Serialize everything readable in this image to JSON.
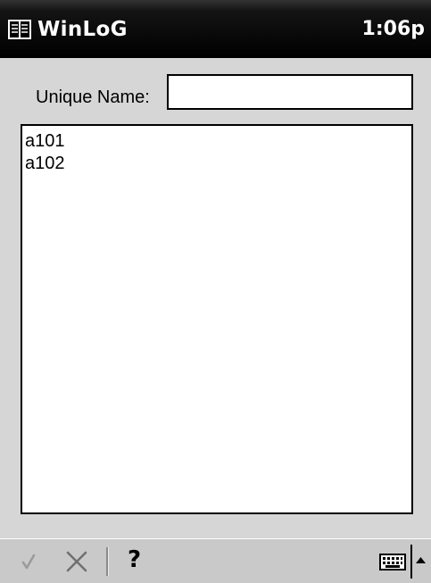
{
  "titlebar": {
    "app_icon": "book-icon",
    "title": "WinLoG",
    "clock": "1:06p"
  },
  "form": {
    "name_label": "Unique Name:",
    "name_value": "",
    "list_items": [
      "a101",
      "a102"
    ]
  },
  "commandbar": {
    "ok_icon": "checkmark-icon",
    "cancel_icon": "x-icon",
    "help_label": "?",
    "keyboard_icon": "keyboard-icon",
    "sip_arrow_icon": "up-arrow-icon"
  },
  "colors": {
    "titlebar": "#000000",
    "form_background": "#d6d6d6",
    "commandbar": "#c9c9c9",
    "disabled_icon": "#9a9a9a"
  }
}
